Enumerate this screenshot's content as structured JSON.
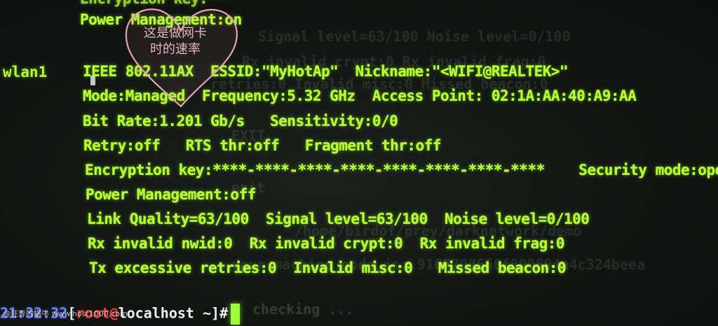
{
  "terminal": {
    "top_cut_line": "Encryption key:*** ",
    "top_power_management": "Power Management:on",
    "interface": "wlan1",
    "lines": [
      "IEEE 802.11AX  ESSID:\"MyHotAp\"  Nickname:\"<WIFI@REALTEK>\"",
      "Mode:Managed  Frequency:5.32 GHz  Access Point: 02:1A:AA:40:A9:AA",
      "Bit Rate:1.201 Gb/s   Sensitivity:0/0",
      "Retry:off   RTS thr:off   Fragment thr:off",
      "Encryption key:****-****-****-****-****-****-****-****    Security mode:open",
      "Power Management:off",
      "Link Quality=63/100  Signal level=63/100  Noise level=0/100",
      "Rx invalid nwid:0  Rx invalid crypt:0  Rx invalid frag:0",
      "Tx excessive retries:0  Invalid misc:0   Missed beacon:0"
    ],
    "ghost_lines": [
      "Signal level=63/100  Noise level=0/100",
      "Rx invalid crypt:0  Rx invalid frag:0",
      "retries:0  Invalid misc:0  Missed beacon:0",
      "EXIT",
      "exit",
      "/home/birdof/prey/darknetwork/demo",
      "your machine code is: 9167708666f800894a4c324beea",
      "checking ..."
    ]
  },
  "annotation": {
    "heart_text": "这是做网卡时的速率",
    "heart_color": "#e8a3b0"
  },
  "prompt": {
    "time": "21:32:32",
    "open": "[",
    "user": "root",
    "at": "@",
    "host": "localhost",
    "path": " ~]#"
  },
  "watermark": "@狂奔的蜗牛 www.host1000.com",
  "colors": {
    "terminal_green": "#b6ff2f",
    "time_blue": "#6d86ff",
    "user_red": "#ff3b3b"
  }
}
